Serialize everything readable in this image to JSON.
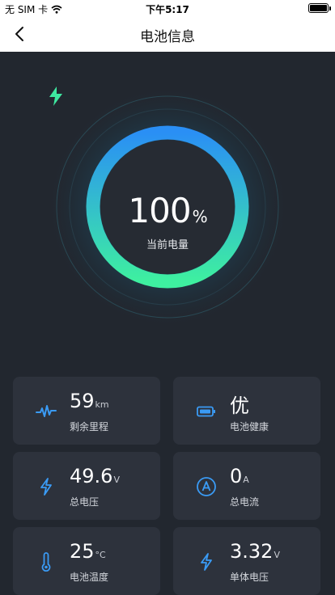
{
  "status": {
    "carrier": "无 SIM 卡",
    "time": "下午5:17"
  },
  "nav": {
    "title": "电池信息"
  },
  "gauge": {
    "value": "100",
    "unit": "%",
    "label": "当前电量",
    "level": 1.0
  },
  "cards": [
    {
      "value": "59",
      "unit": "km",
      "label": "剩余里程",
      "icon": "pulse-icon"
    },
    {
      "value": "优",
      "unit": "",
      "label": "电池健康",
      "icon": "battery-icon"
    },
    {
      "value": "49.6",
      "unit": "V",
      "label": "总电压",
      "icon": "lightning-icon"
    },
    {
      "value": "0",
      "unit": "A",
      "label": "总电流",
      "icon": "ampere-icon"
    },
    {
      "value": "25",
      "unit": "°C",
      "label": "电池温度",
      "icon": "thermometer-icon"
    },
    {
      "value": "3.32",
      "unit": "V",
      "label": "单体电压",
      "icon": "lightning-icon"
    }
  ],
  "colors": {
    "background": "#22272f",
    "card": "#2d323c",
    "accent_blue": "#2d8cf0",
    "accent_green": "#3ee8a0"
  }
}
